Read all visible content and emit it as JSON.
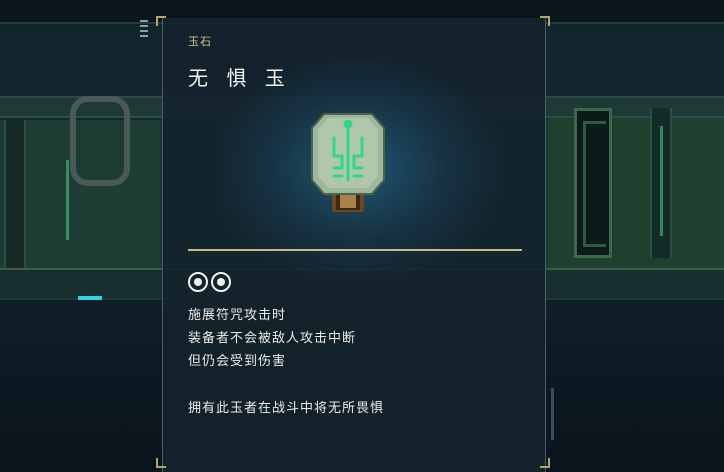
{
  "item": {
    "category": "玉石",
    "name": "无 惧 玉",
    "slots": [
      "filled",
      "filled"
    ],
    "description": [
      "施展符咒攻击时",
      "装备者不会被敌人攻击中断",
      "但仍会受到伤害"
    ],
    "flavor": "拥有此玉者在战斗中将无所畏惧"
  },
  "colors": {
    "accent_gold": "#c9b88a",
    "category_text": "#d8c690",
    "jade_green": "#9fcfa8",
    "rune_glow": "#6ff0b0",
    "panel_bg": "#14222c"
  }
}
